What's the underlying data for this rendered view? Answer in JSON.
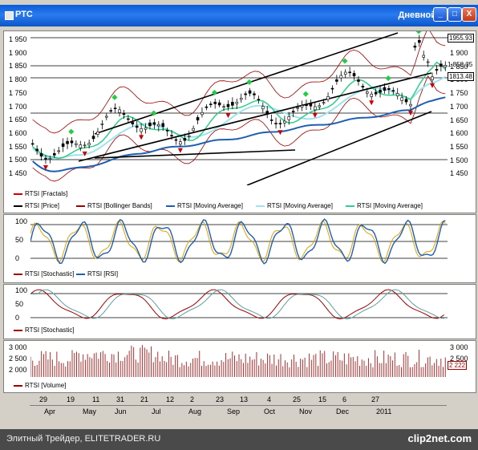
{
  "window": {
    "title": "РТС",
    "period": "Дневной",
    "buttons": [
      "_",
      "□",
      "X"
    ]
  },
  "price_panel": {
    "y_ticks": [
      "1 950",
      "1 900",
      "1 850",
      "1 800",
      "1 750",
      "1 700",
      "1 650",
      "1 600",
      "1 550",
      "1 500",
      "1 450"
    ],
    "right_ticks": [
      "1 900",
      "1 850",
      "1 800",
      "1 750",
      "1 700",
      "1 650",
      "1 600",
      "1 550",
      "1 500",
      "1 450"
    ],
    "price_tags": [
      "1955.93",
      "1 858.35",
      "1813.48"
    ],
    "legend": [
      "RTSI [Fractals]",
      "RTSI [Price]",
      "RTSI [Bollinger Bands]",
      "RTSI [Moving Average]",
      "RTSI [Moving Average]",
      "RTSI [Moving Average]"
    ]
  },
  "oscillator_panel": {
    "y_ticks": [
      "100",
      "50",
      "0"
    ],
    "legend": [
      "RTSI [Stochastic]",
      "RTSI [RSI]"
    ]
  },
  "stochastic_panel": {
    "y_ticks": [
      "100",
      "50",
      "0"
    ],
    "legend": [
      "RTSI [Stochastic]"
    ]
  },
  "volume_panel": {
    "y_ticks": [
      "3 000",
      "2 500",
      "2 000"
    ],
    "right_ticks": [
      "3 000",
      "2 500"
    ],
    "value_tag": "2 222",
    "legend": [
      "RTSI [Volume]"
    ]
  },
  "x_axis": {
    "days": [
      "29",
      "19",
      "11",
      "31",
      "21",
      "12",
      "2",
      "23",
      "13",
      "4",
      "25",
      "15",
      "6",
      "27"
    ],
    "months": [
      "Apr",
      "May",
      "Jun",
      "Jul",
      "Aug",
      "Sep",
      "Oct",
      "Nov",
      "Dec",
      "2011"
    ]
  },
  "colors": {
    "fractal": "#cc0000",
    "price": "#000000",
    "bollinger": "#a00000",
    "ma1": "#1f5fb0",
    "ma2": "#9fe3ee",
    "ma3": "#33cc88",
    "volume": "#b03030"
  },
  "footer": {
    "caption": "Элитный Трейдер, ELITETRADER.RU",
    "brand": "clip2net.com"
  }
}
